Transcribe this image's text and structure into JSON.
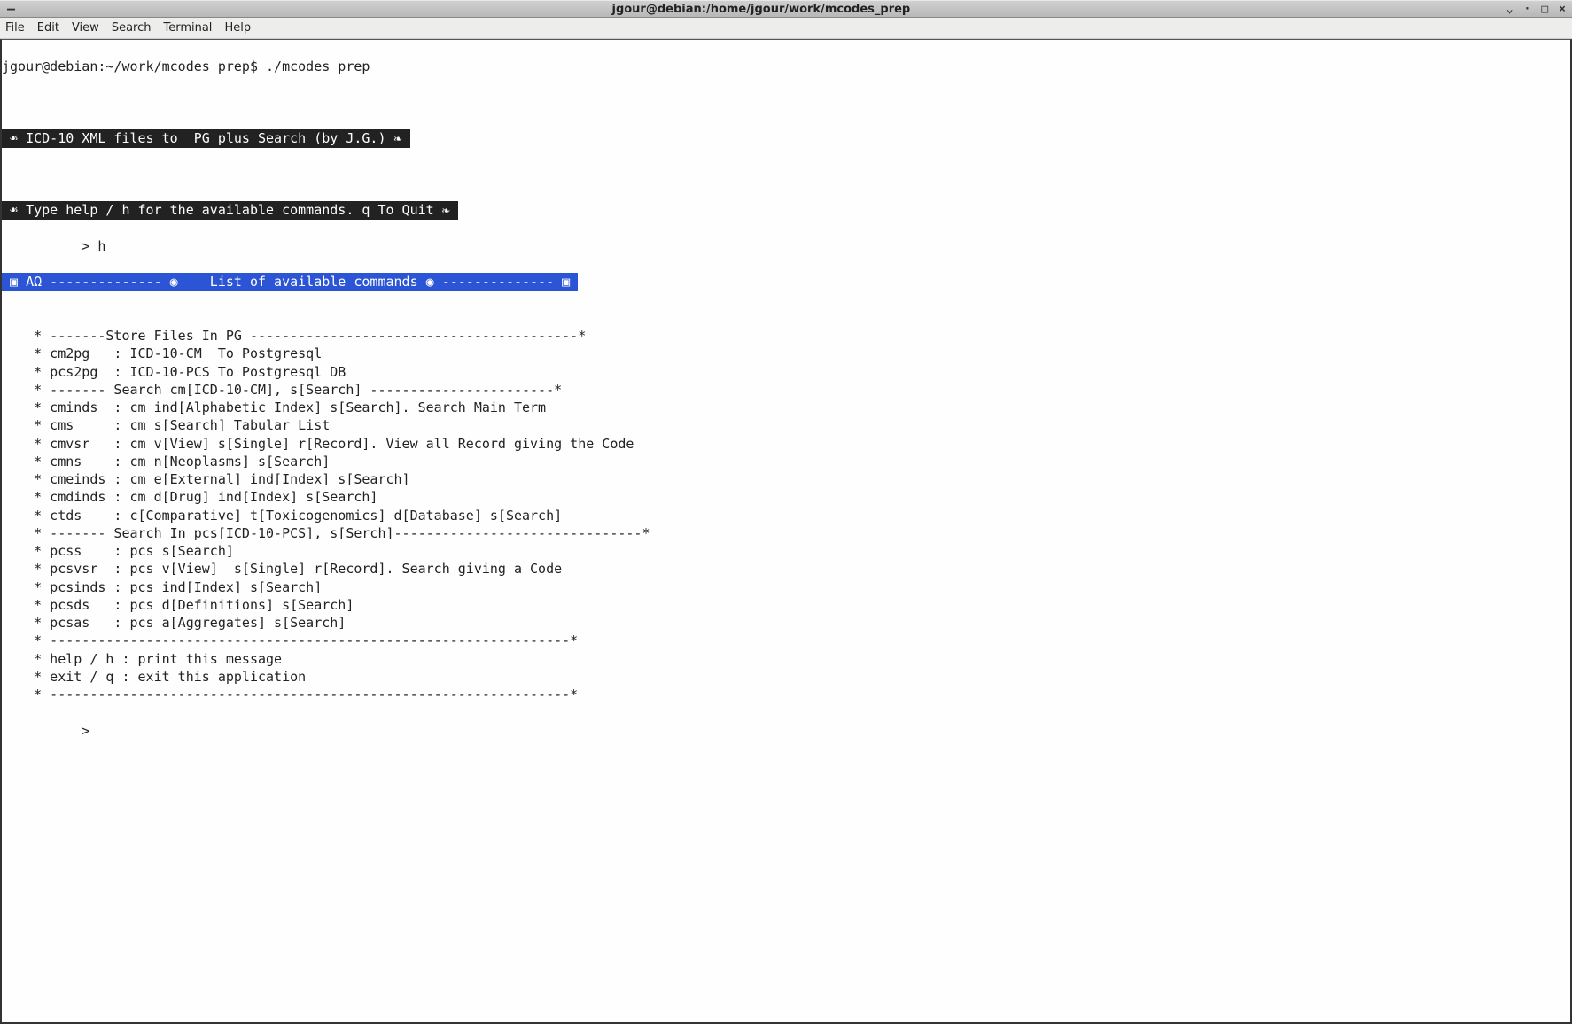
{
  "window": {
    "title": "jgour@debian:/home/jgour/work/mcodes_prep",
    "minimize": "–",
    "iconify": "⌄",
    "pin": "·",
    "maximize": "□",
    "close": "×"
  },
  "menu": {
    "file": "File",
    "edit": "Edit",
    "view": "View",
    "search": "Search",
    "terminal": "Terminal",
    "help": "Help"
  },
  "term": {
    "prompt": "jgour@debian:~/work/mcodes_prep$ ./mcodes_prep",
    "banner1": " ☙ ICD-10 XML files to  PG plus Search (by J.G.) ❧ ",
    "banner2": " ☙ Type help / h for the available commands. q To Quit ❧ ",
    "input1": "          > h",
    "blue": " ▣ ΑΩ -------------- ◉    List of available commands ◉ -------------- ▣ ",
    "lines": [
      "",
      "    * -------Store Files In PG -----------------------------------------*",
      "    * cm2pg   : ICD-10-CM  To Postgresql",
      "    * pcs2pg  : ICD-10-PCS To Postgresql DB",
      "    * ------- Search cm[ICD-10-CM], s[Search] -----------------------*",
      "    * cminds  : cm ind[Alphabetic Index] s[Search]. Search Main Term",
      "    * cms     : cm s[Search] Tabular List",
      "    * cmvsr   : cm v[View] s[Single] r[Record]. View all Record giving the Code",
      "    * cmns    : cm n[Neoplasms] s[Search]",
      "    * cmeinds : cm e[External] ind[Index] s[Search]",
      "    * cmdinds : cm d[Drug] ind[Index] s[Search]",
      "    * ctds    : c[Comparative] t[Toxicogenomics] d[Database] s[Search]",
      "    * ------- Search In pcs[ICD-10-PCS], s[Serch]-------------------------------*",
      "    * pcss    : pcs s[Search]",
      "    * pcsvsr  : pcs v[View]  s[Single] r[Record]. Search giving a Code",
      "    * pcsinds : pcs ind[Index] s[Search]",
      "    * pcsds   : pcs d[Definitions] s[Search]",
      "    * pcsas   : pcs a[Aggregates] s[Search]",
      "    * -----------------------------------------------------------------*",
      "    * help / h : print this message",
      "    * exit / q : exit this application",
      "    * -----------------------------------------------------------------*",
      "",
      "          > "
    ]
  }
}
